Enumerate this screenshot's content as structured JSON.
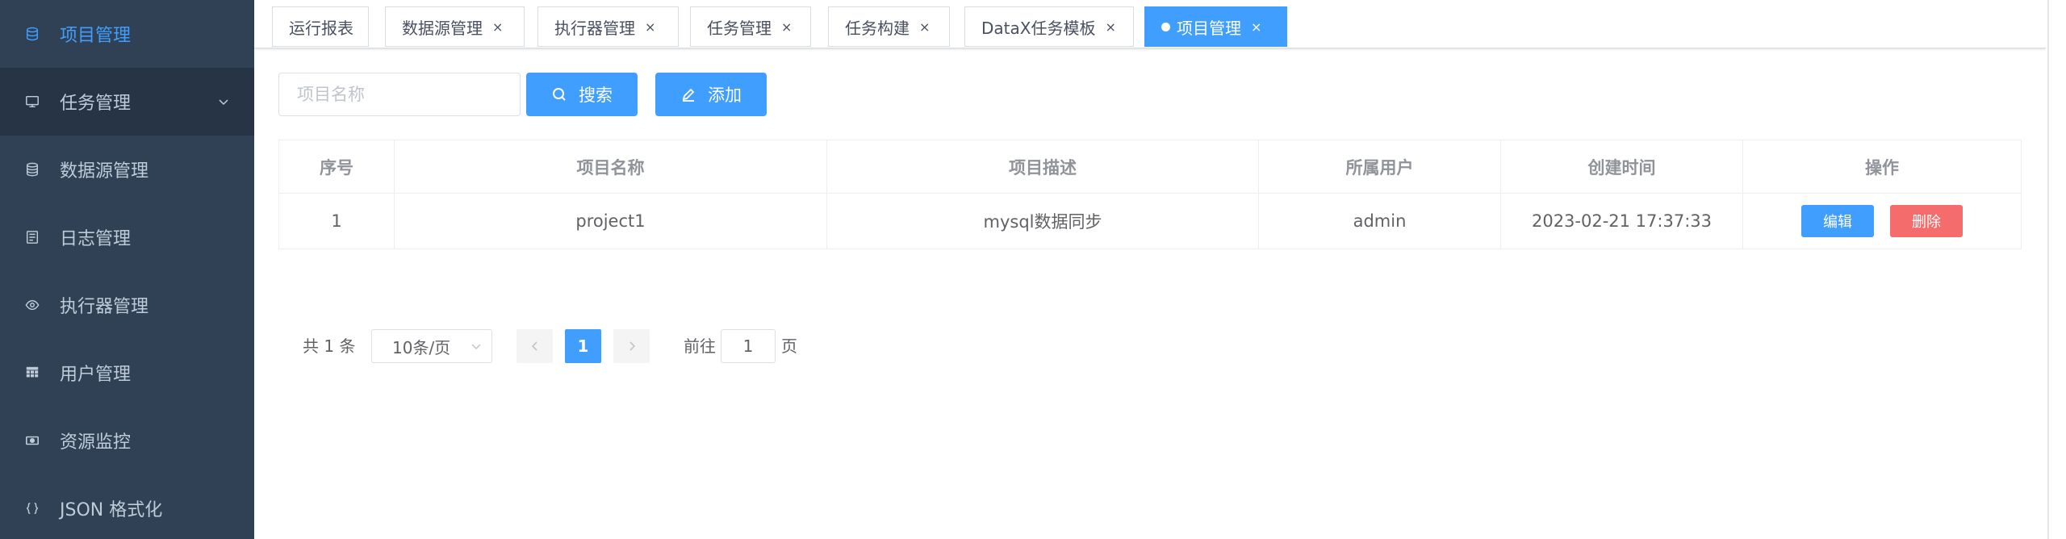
{
  "sidebar": {
    "items": [
      {
        "label": "项目管理",
        "icon": "database-icon",
        "active": true
      },
      {
        "label": "任务管理",
        "icon": "monitor-icon",
        "opened": true
      },
      {
        "label": "数据源管理",
        "icon": "database-stack-icon"
      },
      {
        "label": "日志管理",
        "icon": "document-icon"
      },
      {
        "label": "执行器管理",
        "icon": "eye-icon"
      },
      {
        "label": "用户管理",
        "icon": "grid-icon"
      },
      {
        "label": "资源监控",
        "icon": "money-icon"
      },
      {
        "label": "JSON 格式化",
        "icon": "braces-icon"
      }
    ]
  },
  "tags": [
    {
      "label": "运行报表",
      "closable": false
    },
    {
      "label": "数据源管理",
      "closable": true,
      "close": "×"
    },
    {
      "label": "执行器管理",
      "closable": true,
      "close": "×"
    },
    {
      "label": "任务管理",
      "closable": true,
      "close": "×"
    },
    {
      "label": "任务构建",
      "closable": true,
      "close": "×"
    },
    {
      "label": "DataX任务模板",
      "closable": true,
      "close": "×"
    },
    {
      "label": "项目管理",
      "closable": true,
      "close": "×",
      "active": true
    }
  ],
  "filter": {
    "placeholder": "项目名称",
    "search_label": "搜索",
    "add_label": "添加"
  },
  "table": {
    "headers": [
      "序号",
      "项目名称",
      "项目描述",
      "所属用户",
      "创建时间",
      "操作"
    ],
    "rows": [
      {
        "index": "1",
        "name": "project1",
        "desc": "mysql数据同步",
        "user": "admin",
        "created": "2023-02-21 17:37:33"
      }
    ],
    "edit_label": "编辑",
    "delete_label": "删除"
  },
  "pagination": {
    "total_text": "共 1 条",
    "page_size": "10条/页",
    "current_page": "1",
    "goto_prefix": "前往",
    "goto_value": "1",
    "goto_suffix": "页"
  },
  "colors": {
    "sidebar_bg": "#304156",
    "accent": "#409eff",
    "danger": "#f56c6c"
  }
}
